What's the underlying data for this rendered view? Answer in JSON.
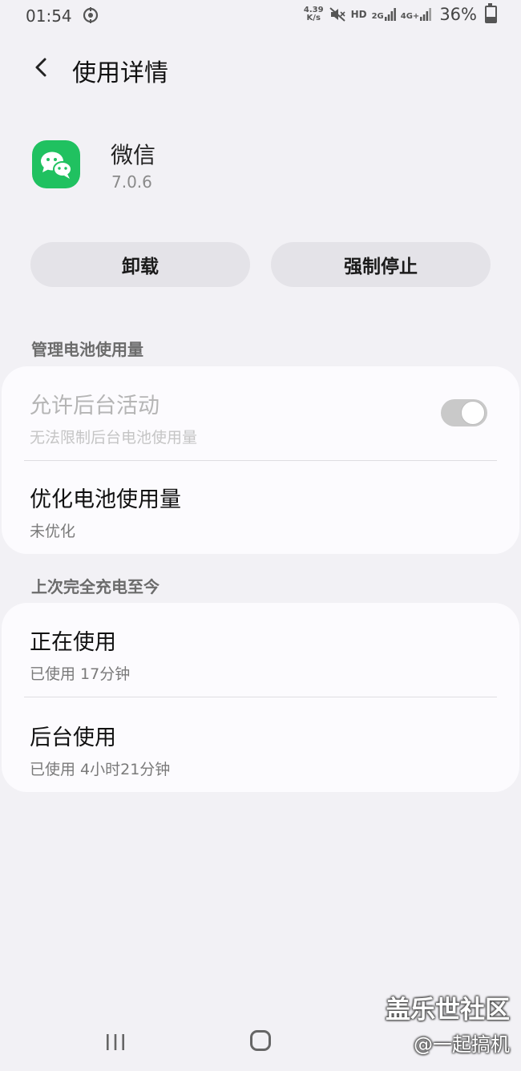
{
  "status_bar": {
    "time": "01:54",
    "speed_value": "4.39",
    "speed_unit": "K/s",
    "hd": "HD",
    "network_2g": "2G",
    "network_4g": "4G+",
    "battery_pct": "36%",
    "battery_level": 0.36
  },
  "header": {
    "title": "使用详情",
    "back_icon": "back-arrow-icon"
  },
  "app": {
    "name": "微信",
    "version": "7.0.6",
    "icon": "wechat-icon",
    "icon_color": "#20c160"
  },
  "actions": {
    "uninstall_label": "卸载",
    "force_stop_label": "强制停止"
  },
  "battery_section": {
    "title": "管理电池使用量",
    "items": [
      {
        "title": "允许后台活动",
        "subtitle": "无法限制后台电池使用量",
        "toggle_on": true,
        "enabled": false
      },
      {
        "title": "优化电池使用量",
        "subtitle": "未优化"
      }
    ]
  },
  "usage_section": {
    "title": "上次完全充电至今",
    "items": [
      {
        "title": "正在使用",
        "subtitle": "已使用 17分钟"
      },
      {
        "title": "后台使用",
        "subtitle": "已使用 4小时21分钟"
      }
    ]
  },
  "watermark": {
    "line1": "盖乐世社区",
    "line2": "@一起搞机"
  }
}
